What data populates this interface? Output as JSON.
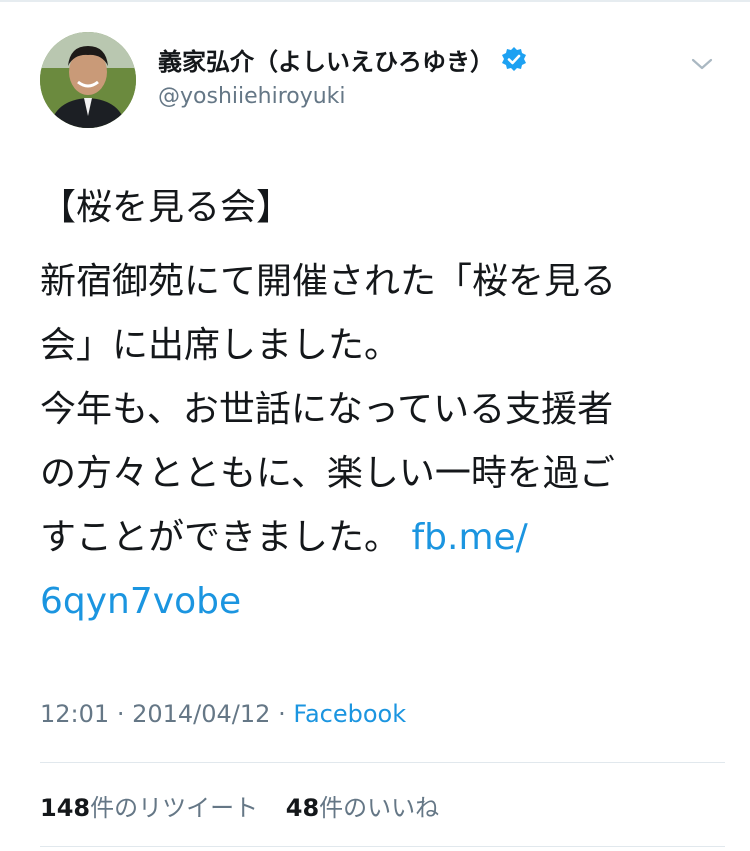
{
  "author": {
    "display_name": "義家弘介（よしいえひろゆき）",
    "handle": "@yoshiiehiroyuki",
    "verified_icon": "verified-badge-icon",
    "avatar_icon": "profile-photo"
  },
  "menu": {
    "icon": "chevron-down-icon"
  },
  "tweet": {
    "heading": "【桜を見る会】",
    "lines": [
      "新宿御苑にて開催された「桜を見る",
      "会」に出席しました。",
      "今年も、お世話になっている支援者",
      "の方々とともに、楽しい一時を過ご"
    ],
    "last_line_text": "すことができました。",
    "link_part1": "fb.me/",
    "link_part2": "6qyn7vobe"
  },
  "meta": {
    "time": "12:01",
    "separator1": "·",
    "date": "2014/04/12",
    "separator2": "·",
    "source": "Facebook"
  },
  "stats": {
    "retweet_count": "148",
    "retweet_label": "件のリツイート",
    "like_count": "48",
    "like_label": "件のいいね"
  },
  "colors": {
    "link": "#1b95e0",
    "muted": "#657786",
    "text": "#14171a",
    "verified": "#1da1f2"
  }
}
